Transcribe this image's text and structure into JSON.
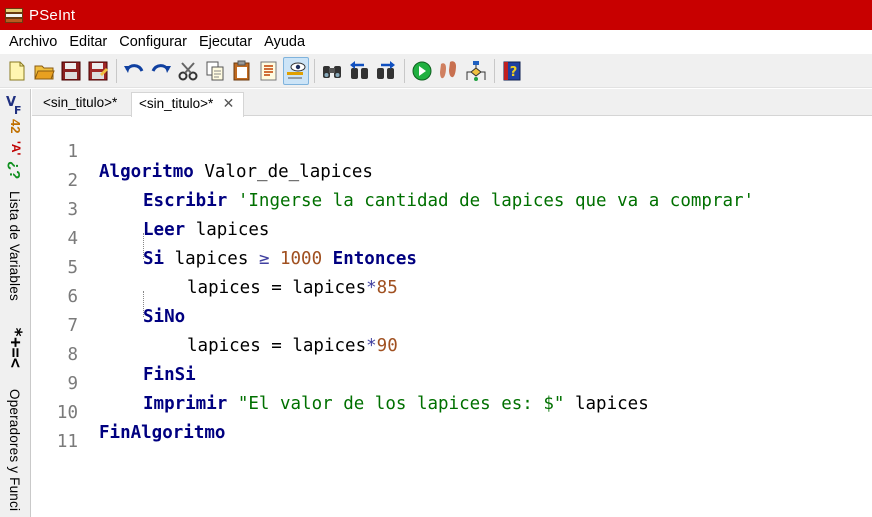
{
  "window": {
    "title": "PSeInt"
  },
  "menu": [
    "Archivo",
    "Editar",
    "Configurar",
    "Ejecutar",
    "Ayuda"
  ],
  "toolbar": {
    "buttons": [
      "new-file-icon",
      "open-folder-icon",
      "save-icon",
      "save-as-icon",
      "undo-icon",
      "redo-icon",
      "cut-icon",
      "copy-icon",
      "paste-icon",
      "select-all-icon",
      "highlight-selection-icon",
      "find-icon",
      "find-prev-icon",
      "find-next-icon",
      "run-icon",
      "step-by-step-icon",
      "flowchart-icon",
      "help-icon"
    ]
  },
  "side_panel": {
    "variables_label": "Lista de Variables",
    "operators_label": "Operadores y Funci",
    "ops_symbols": "*+=<",
    "vf_v": "V",
    "vf_f": "F",
    "n42": "42",
    "a_quote": "'A'",
    "question": "¿?"
  },
  "tabs": [
    {
      "label": "<sin_titulo>*"
    },
    {
      "label": "<sin_titulo>*",
      "close": "✕"
    }
  ],
  "code": {
    "line_numbers": [
      "1",
      "2",
      "3",
      "4",
      "5",
      "6",
      "7",
      "8",
      "9",
      "10",
      "11"
    ],
    "lines": [
      {
        "kw": "Algoritmo",
        "rest": " Valor_de_lapices"
      },
      {
        "kw": "Escribir",
        "str": " 'Ingerse la cantidad de lapices que va a comprar'"
      },
      {
        "kw": "Leer",
        "rest": " lapices"
      },
      {
        "kw": "Si",
        "rest": " lapices ",
        "op": "≥",
        "num": " 1000",
        "kw2": " Entonces"
      },
      {
        "rest": "lapices = lapices",
        "op": "*",
        "num": "85"
      },
      {
        "kw": "SiNo"
      },
      {
        "rest": "lapices = lapices",
        "op": "*",
        "num": "90"
      },
      {
        "kw": "FinSi"
      },
      {
        "kw": "Imprimir",
        "str": " \"El valor de los lapices es: $\"",
        "rest": " lapices"
      },
      {
        "kw": "FinAlgoritmo"
      },
      {}
    ]
  }
}
